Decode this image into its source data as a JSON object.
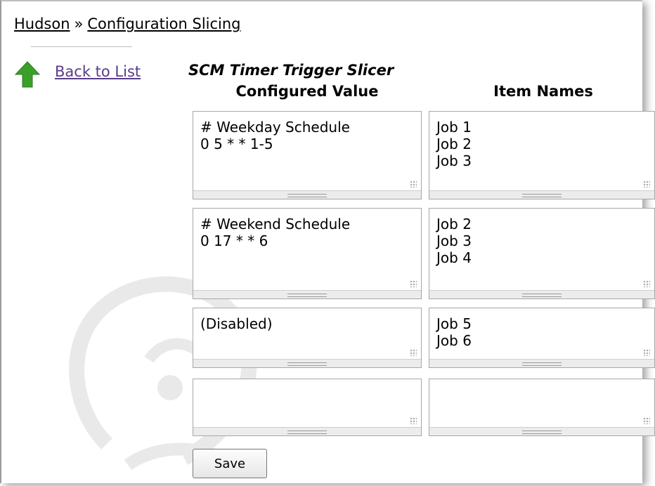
{
  "breadcrumb": {
    "home": "Hudson",
    "separator": "»",
    "current": "Configuration Slicing"
  },
  "back_link": {
    "label": "Back to List",
    "icon": "up-arrow-icon",
    "icon_color": "#3aa02a"
  },
  "section_title": "SCM Timer Trigger Slicer",
  "columns": {
    "configured": "Configured Value",
    "items": "Item Names"
  },
  "rows": [
    {
      "configured": "# Weekday Schedule\n0 5 * * 1-5",
      "items": "Job 1\nJob 2\nJob 3"
    },
    {
      "configured": "# Weekend Schedule\n0 17 * * 6",
      "items": "Job 2\nJob 3\nJob 4"
    },
    {
      "configured": "(Disabled)",
      "items": "Job 5\nJob 6"
    },
    {
      "configured": "",
      "items": ""
    }
  ],
  "save_label": "Save"
}
